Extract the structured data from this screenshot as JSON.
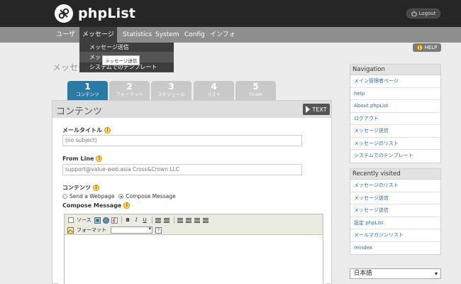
{
  "header": {
    "brand": "phpList",
    "logout_label": "Logout"
  },
  "nav": {
    "items": [
      "ユーザ",
      "メッセージ",
      "Statistics",
      "System",
      "Config",
      "インフォ"
    ],
    "active": "メッセージ"
  },
  "dropdown": {
    "items": [
      "メッセージ送信",
      "メッ",
      "システムでのテンプレート"
    ],
    "tooltip": "メッセージ送信"
  },
  "help_label": "HELP",
  "page_title": "メッセー",
  "wizard": {
    "tabs": [
      {
        "num": "1",
        "label": "コンテンツ"
      },
      {
        "num": "2",
        "label": "フォーマット"
      },
      {
        "num": "3",
        "label": "スケジュール"
      },
      {
        "num": "4",
        "label": "リスト"
      },
      {
        "num": "5",
        "label": "Finish"
      }
    ],
    "active_index": 0
  },
  "panel": {
    "title": "コンテンツ",
    "text_button": "TEXT"
  },
  "form": {
    "mail_title_label": "メールタイトル",
    "mail_title_value": "(no subject)",
    "from_label": "From Line",
    "from_value": "support@value-web.asia Cross&Crown LLC",
    "content_label": "コンテンツ",
    "radio_webpage": "Send a Webpage",
    "radio_compose": "Compose Message",
    "selected_radio": "Compose Message",
    "compose_label": "Compose Message"
  },
  "editor": {
    "source_label": "ソース",
    "bold": "B",
    "italic": "I",
    "underline": "U",
    "format_label": "フォーマット",
    "help_glyph": "?"
  },
  "sidebar": {
    "navigation_title": "Navigation",
    "navigation_items": [
      "メイン管理者ページ",
      "help",
      "About phpList",
      "ログアウト",
      "メッセージ送信",
      "メッセージのリスト",
      "システムでのテンプレート"
    ],
    "recent_title": "Recently visited",
    "recent_items": [
      "メッセージのリスト",
      "メッセージ送信",
      "メッセージ送信",
      "設定 phpList",
      "メールマガジンリスト",
      "reindex"
    ],
    "language": "日本語"
  },
  "colors": {
    "topbar": "#262626",
    "navbar": "#8e8e8e",
    "active_tab": "#2a7aa6",
    "inactive_tab": "#c9c9c9",
    "link": "#2a6fa0",
    "info_icon": "#ffdb55"
  }
}
